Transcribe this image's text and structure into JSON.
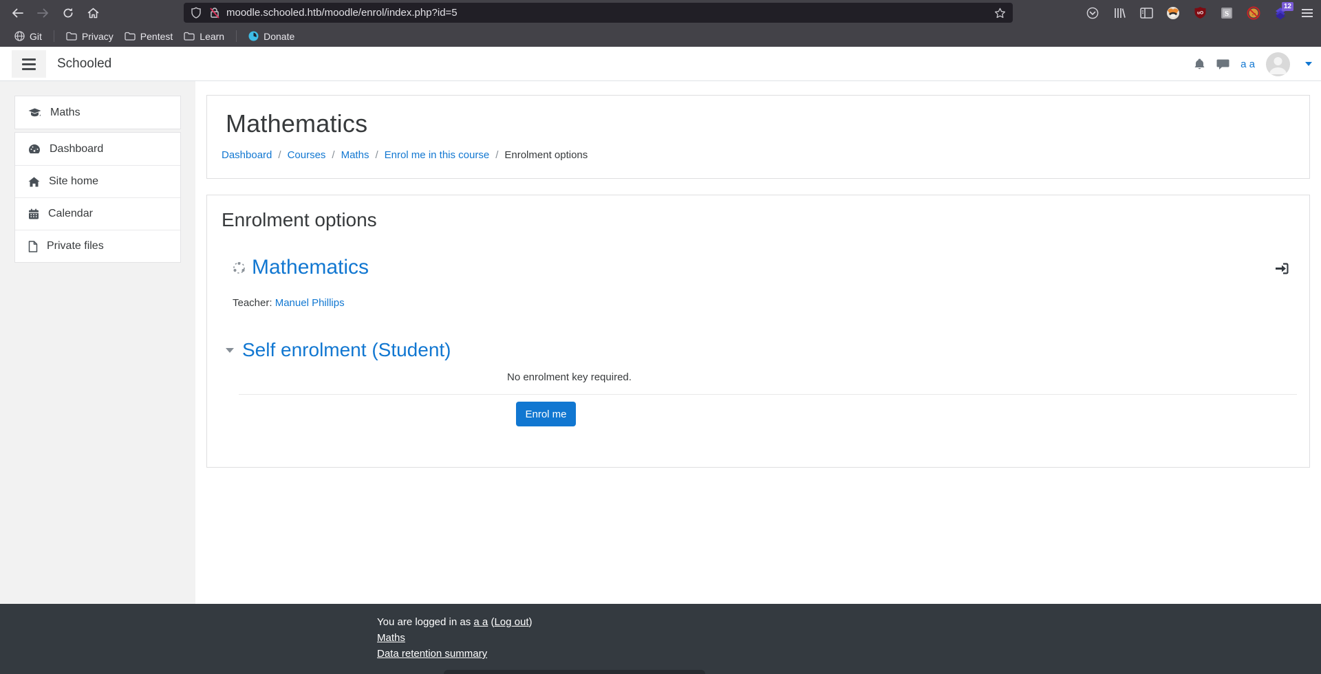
{
  "browser": {
    "url": "moodle.schooled.htb/moodle/enrol/index.php?id=5",
    "extension_badge": "12",
    "bookmarks": [
      {
        "label": "Git"
      },
      {
        "label": "Privacy"
      },
      {
        "label": "Pentest"
      },
      {
        "label": "Learn"
      },
      {
        "label": "Donate"
      }
    ]
  },
  "header": {
    "brand": "Schooled",
    "user": "a a"
  },
  "sidebar": {
    "items": [
      {
        "label": "Maths"
      },
      {
        "label": "Dashboard"
      },
      {
        "label": "Site home"
      },
      {
        "label": "Calendar"
      },
      {
        "label": "Private files"
      }
    ]
  },
  "page": {
    "title": "Mathematics",
    "breadcrumb_sep": "/",
    "breadcrumb": [
      "Dashboard",
      "Courses",
      "Maths",
      "Enrol me in this course",
      "Enrolment options"
    ]
  },
  "enrol": {
    "heading": "Enrolment options",
    "course_name": "Mathematics",
    "teacher_label": "Teacher:",
    "teacher_name": "Manuel Phillips",
    "self_enrol_heading": "Self enrolment (Student)",
    "no_key_text": "No enrolment key required.",
    "enrol_button": "Enrol me"
  },
  "footer": {
    "logged_in_prefix": "You are logged in as",
    "user_link": "a a",
    "paren_open": "(",
    "logout_link": "Log out",
    "paren_close": ")",
    "course_link": "Maths",
    "retention_link": "Data retention summary"
  },
  "colors": {
    "link_blue": "#1177d1",
    "footer_bg": "#343a40",
    "toolbar_bg": "#434248",
    "sidebar_bg": "#f2f2f2"
  }
}
